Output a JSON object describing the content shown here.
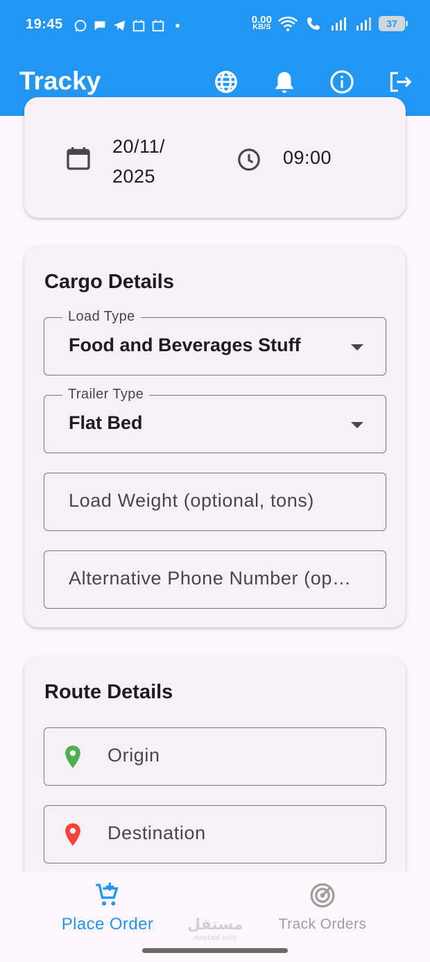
{
  "status_bar": {
    "time": "19:45",
    "net_speed_value": "0.00",
    "net_speed_unit": "KB/S",
    "battery": "37"
  },
  "app_bar": {
    "title": "Tracky",
    "actions": [
      "globe-icon",
      "bell-icon",
      "info-icon",
      "logout-icon"
    ]
  },
  "schedule": {
    "date": "20/11/ 2025",
    "time": "09:00"
  },
  "cargo": {
    "title": "Cargo Details",
    "load_type": {
      "label": "Load Type",
      "value": "Food and Beverages Stuff"
    },
    "trailer_type": {
      "label": "Trailer Type",
      "value": "Flat Bed"
    },
    "load_weight": {
      "placeholder": "Load Weight (optional, tons)"
    },
    "alt_phone": {
      "placeholder": "Alternative Phone Number (op…"
    }
  },
  "route": {
    "title": "Route Details",
    "origin": {
      "placeholder": "Origin"
    },
    "destination": {
      "placeholder": "Destination"
    }
  },
  "bottom_nav": {
    "place_order": "Place Order",
    "track_orders": "Track Orders",
    "watermark": "مستقل",
    "watermark_sub": "mostaql.com"
  },
  "colors": {
    "primary": "#2196f3",
    "origin_pin": "#4caf50",
    "destination_pin": "#f44336"
  }
}
